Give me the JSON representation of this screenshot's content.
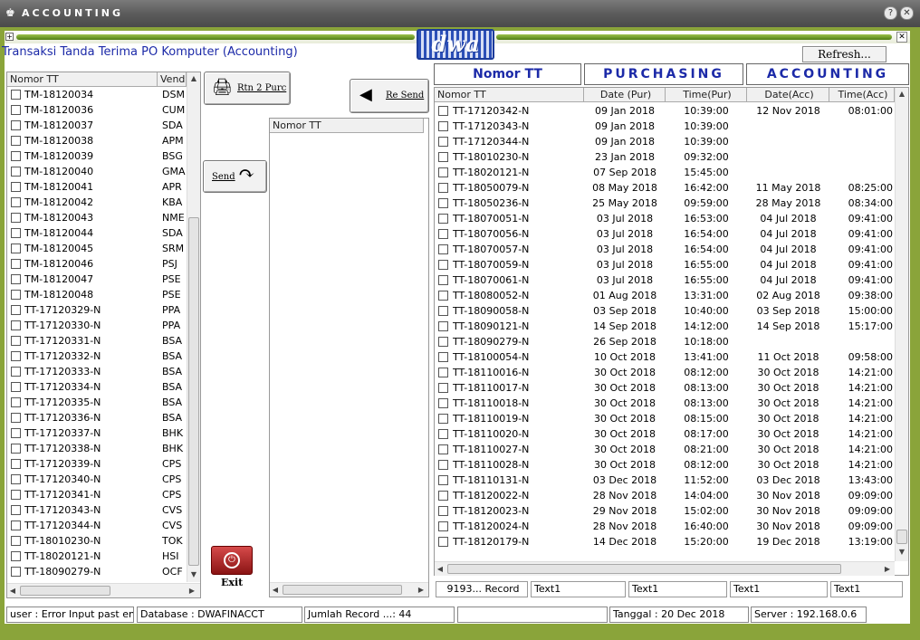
{
  "window": {
    "title": "ACCOUNTING",
    "icon": "app-icon"
  },
  "header": {
    "page_title": "Transaksi  Tanda Terima PO Komputer (Accounting)",
    "refresh_label": "Refresh...",
    "logo_text": "dwa"
  },
  "left_list": {
    "columns": [
      "Nomor TT",
      "Vend"
    ],
    "rows": [
      [
        "TM-18120034",
        "DSM"
      ],
      [
        "TM-18120036",
        "CUM"
      ],
      [
        "TM-18120037",
        "SDA"
      ],
      [
        "TM-18120038",
        "APM"
      ],
      [
        "TM-18120039",
        "BSG"
      ],
      [
        "TM-18120040",
        "GMA"
      ],
      [
        "TM-18120041",
        "APR"
      ],
      [
        "TM-18120042",
        "KBA"
      ],
      [
        "TM-18120043",
        "NME"
      ],
      [
        "TM-18120044",
        "SDA"
      ],
      [
        "TM-18120045",
        "SRM"
      ],
      [
        "TM-18120046",
        "PSJ"
      ],
      [
        "TM-18120047",
        "PSE"
      ],
      [
        "TM-18120048",
        "PSE"
      ],
      [
        "TT-17120329-N",
        "PPA"
      ],
      [
        "TT-17120330-N",
        "PPA"
      ],
      [
        "TT-17120331-N",
        "BSA"
      ],
      [
        "TT-17120332-N",
        "BSA"
      ],
      [
        "TT-17120333-N",
        "BSA"
      ],
      [
        "TT-17120334-N",
        "BSA"
      ],
      [
        "TT-17120335-N",
        "BSA"
      ],
      [
        "TT-17120336-N",
        "BSA"
      ],
      [
        "TT-17120337-N",
        "BHK"
      ],
      [
        "TT-17120338-N",
        "BHK"
      ],
      [
        "TT-17120339-N",
        "CPS"
      ],
      [
        "TT-17120340-N",
        "CPS"
      ],
      [
        "TT-17120341-N",
        "CPS"
      ],
      [
        "TT-17120343-N",
        "CVS"
      ],
      [
        "TT-17120344-N",
        "CVS"
      ],
      [
        "TT-18010230-N",
        "TOK"
      ],
      [
        "TT-18020121-N",
        "HSI"
      ],
      [
        "TT-18090279-N",
        "OCF"
      ]
    ]
  },
  "buttons": {
    "rtn2purc": "Rtn 2 Purc",
    "resend": "Re Send",
    "send": "Send",
    "exit": "Exit"
  },
  "middle_list": {
    "columns": [
      "Nomor TT"
    ]
  },
  "right_groups": {
    "nomor": "Nomor TT",
    "purchasing": "PURCHASING",
    "accounting": "ACCOUNTING"
  },
  "right_grid": {
    "columns": [
      "Nomor TT",
      "Date (Pur)",
      "Time(Pur)",
      "Date(Acc)",
      "Time(Acc)"
    ],
    "rows": [
      [
        "TT-17120342-N",
        "09 Jan 2018",
        "10:39:00",
        "12 Nov 2018",
        "08:01:00"
      ],
      [
        "TT-17120343-N",
        "09 Jan 2018",
        "10:39:00",
        "",
        ""
      ],
      [
        "TT-17120344-N",
        "09 Jan 2018",
        "10:39:00",
        "",
        ""
      ],
      [
        "TT-18010230-N",
        "23 Jan 2018",
        "09:32:00",
        "",
        ""
      ],
      [
        "TT-18020121-N",
        "07 Sep 2018",
        "15:45:00",
        "",
        ""
      ],
      [
        "TT-18050079-N",
        "08 May 2018",
        "16:42:00",
        "11 May 2018",
        "08:25:00"
      ],
      [
        "TT-18050236-N",
        "25 May 2018",
        "09:59:00",
        "28 May 2018",
        "08:34:00"
      ],
      [
        "TT-18070051-N",
        "03 Jul 2018",
        "16:53:00",
        "04 Jul 2018",
        "09:41:00"
      ],
      [
        "TT-18070056-N",
        "03 Jul 2018",
        "16:54:00",
        "04 Jul 2018",
        "09:41:00"
      ],
      [
        "TT-18070057-N",
        "03 Jul 2018",
        "16:54:00",
        "04 Jul 2018",
        "09:41:00"
      ],
      [
        "TT-18070059-N",
        "03 Jul 2018",
        "16:55:00",
        "04 Jul 2018",
        "09:41:00"
      ],
      [
        "TT-18070061-N",
        "03 Jul 2018",
        "16:55:00",
        "04 Jul 2018",
        "09:41:00"
      ],
      [
        "TT-18080052-N",
        "01 Aug 2018",
        "13:31:00",
        "02 Aug 2018",
        "09:38:00"
      ],
      [
        "TT-18090058-N",
        "03 Sep 2018",
        "10:40:00",
        "03 Sep 2018",
        "15:00:00"
      ],
      [
        "TT-18090121-N",
        "14 Sep 2018",
        "14:12:00",
        "14 Sep 2018",
        "15:17:00"
      ],
      [
        "TT-18090279-N",
        "26 Sep 2018",
        "10:18:00",
        "",
        ""
      ],
      [
        "TT-18100054-N",
        "10 Oct 2018",
        "13:41:00",
        "11 Oct 2018",
        "09:58:00"
      ],
      [
        "TT-18110016-N",
        "30 Oct 2018",
        "08:12:00",
        "30 Oct 2018",
        "14:21:00"
      ],
      [
        "TT-18110017-N",
        "30 Oct 2018",
        "08:13:00",
        "30 Oct 2018",
        "14:21:00"
      ],
      [
        "TT-18110018-N",
        "30 Oct 2018",
        "08:13:00",
        "30 Oct 2018",
        "14:21:00"
      ],
      [
        "TT-18110019-N",
        "30 Oct 2018",
        "08:15:00",
        "30 Oct 2018",
        "14:21:00"
      ],
      [
        "TT-18110020-N",
        "30 Oct 2018",
        "08:17:00",
        "30 Oct 2018",
        "14:21:00"
      ],
      [
        "TT-18110027-N",
        "30 Oct 2018",
        "08:21:00",
        "30 Oct 2018",
        "14:21:00"
      ],
      [
        "TT-18110028-N",
        "30 Oct 2018",
        "08:12:00",
        "30 Oct 2018",
        "14:21:00"
      ],
      [
        "TT-18110131-N",
        "03 Dec 2018",
        "11:52:00",
        "03 Dec 2018",
        "13:43:00"
      ],
      [
        "TT-18120022-N",
        "28 Nov 2018",
        "14:04:00",
        "30 Nov 2018",
        "09:09:00"
      ],
      [
        "TT-18120023-N",
        "29 Nov 2018",
        "15:02:00",
        "30 Nov 2018",
        "09:09:00"
      ],
      [
        "TT-18120024-N",
        "28 Nov 2018",
        "16:40:00",
        "30 Nov 2018",
        "09:09:00"
      ],
      [
        "TT-18120179-N",
        "14 Dec 2018",
        "15:20:00",
        "19 Dec 2018",
        "13:19:00"
      ]
    ]
  },
  "record_bar": {
    "records": "9193... Record",
    "text1": "Text1",
    "text2": "Text1",
    "text3": "Text1",
    "text4": "Text1"
  },
  "statusbar": {
    "user": "user : Error Input past end of",
    "database": "Database : DWAFINACCT",
    "jumlah": "Jumlah Record ...: 44",
    "blank": "",
    "tanggal": "Tanggal  :  20 Dec 2018",
    "server": "Server  :  192.168.0.6"
  }
}
